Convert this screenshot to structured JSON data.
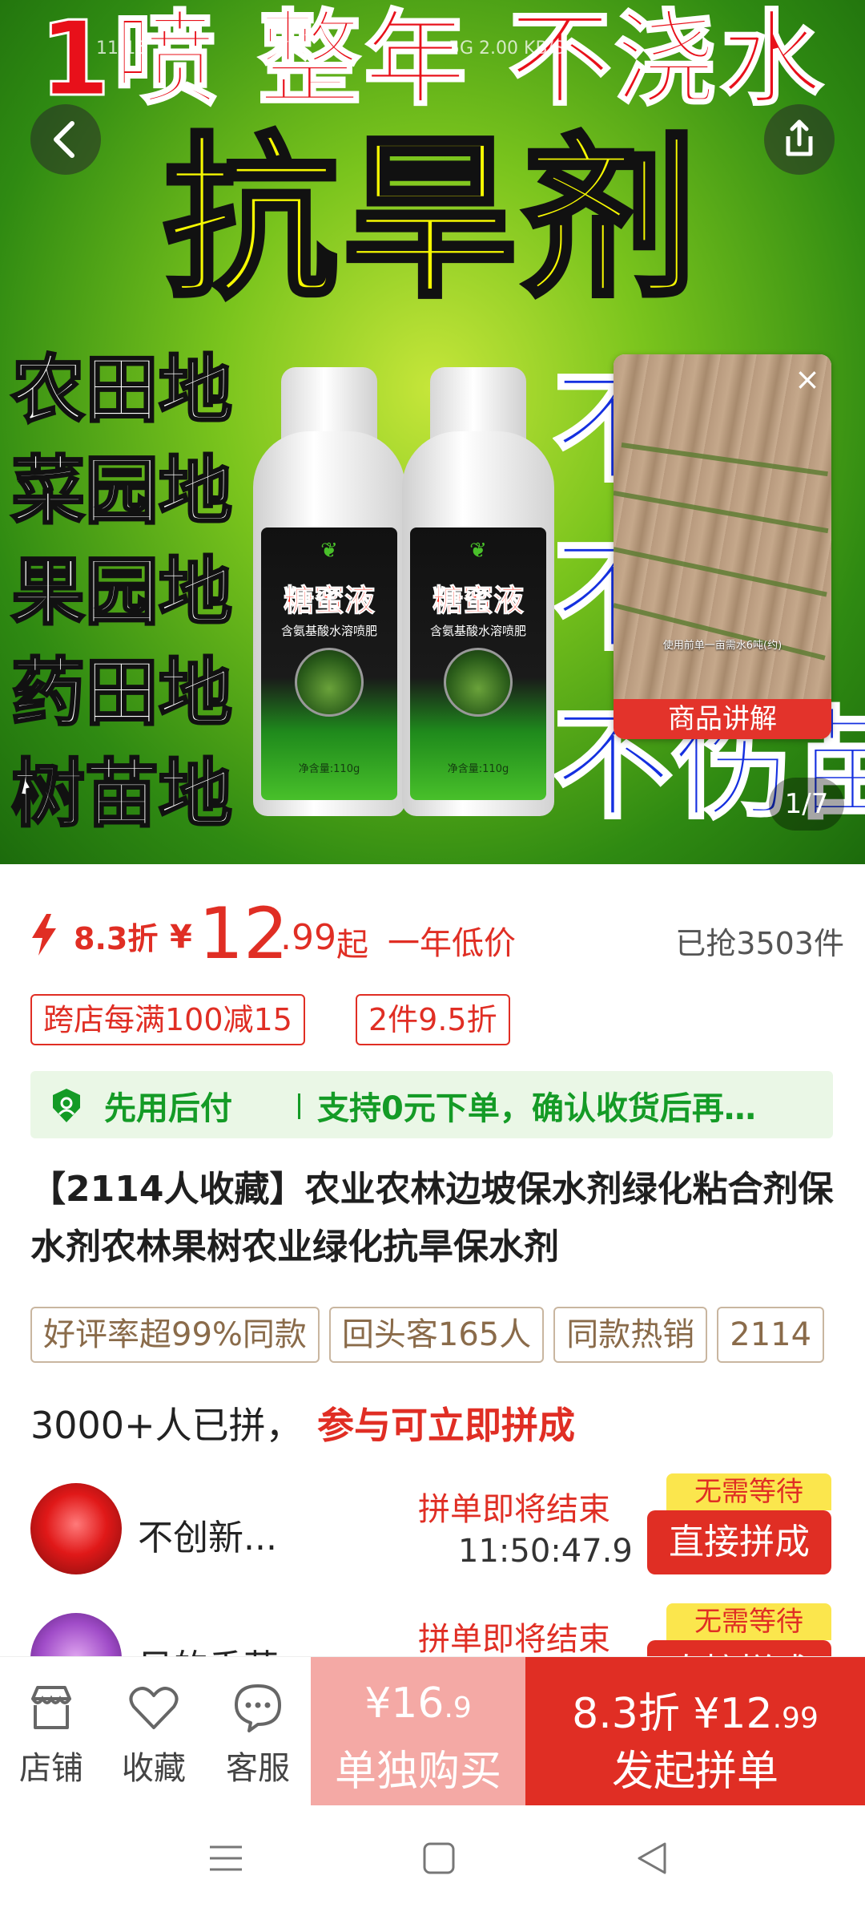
{
  "hero": {
    "headline": "1喷 整年 不浇水",
    "subhead": "抗旱剂",
    "uses": [
      "农田地",
      "菜园地",
      "果园地",
      "药田地",
      "树苗地"
    ],
    "right_lines": [
      "不伤",
      "不旱",
      "不伤苗"
    ],
    "bottle": {
      "brand": "糖蜜液",
      "description": "含氨基酸水溶喷肥",
      "net": "净含量:110g"
    },
    "status_bar": {
      "left": "11:15",
      "right": "5G 2.00 KB/S"
    },
    "counter": "1/7"
  },
  "video_pip": {
    "caption": "使用前单一亩需水6吨(约)",
    "label": "商品讲解"
  },
  "price": {
    "discount": "8.3折",
    "currency": "¥",
    "integer": "12",
    "decimal": ".99",
    "suffix": "起",
    "slogan": "一年低价",
    "sold": "已抢3503件"
  },
  "coupons": [
    "跨店每满100减15",
    "2件9.5折"
  ],
  "bnpl": {
    "title": "先用后付",
    "text": "支持0元下单，确认收货后再…"
  },
  "product_title": "【2114人收藏】农业农林边坡保水剂绿化粘合剂保水剂农林果树农业绿化抗旱保水剂",
  "tags": [
    "好评率超99%同款",
    "回头客165人",
    "同款热销",
    "2114"
  ],
  "group_buy": {
    "count_text": "3000+人已拼，",
    "join_text": "参与可立即拼成",
    "rows": [
      {
        "name": "不创新...",
        "status": "拼单即将结束",
        "timer": "11:50:47.9",
        "badge": "无需等待",
        "button": "直接拼成"
      },
      {
        "name": "风的香草...",
        "status": "拼单即将结束",
        "timer": "",
        "badge": "无需等待",
        "button": "直接拼成"
      }
    ]
  },
  "bottom_bar": {
    "store": "店铺",
    "favorite": "收藏",
    "service": "客服",
    "buy_alone_price_int": "¥16",
    "buy_alone_price_dec": ".9",
    "buy_alone_label": "单独购买",
    "buy_group_price": "8.3折 ¥12",
    "buy_group_price_dec": ".99",
    "buy_group_label": "发起拼单"
  },
  "icons": {
    "back": "chevron-left-icon",
    "share": "share-icon",
    "close": "close-icon",
    "bolt": "lightning-icon",
    "bnpl": "shield-check-icon",
    "store": "store-icon",
    "favorite": "heart-icon",
    "service": "chat-icon"
  },
  "colors": {
    "accent": "#e02e24",
    "bnpl_green": "#149b26",
    "tag_brown": "#8a6b4a",
    "badge_yellow": "#fbe64d",
    "buy_alone_bg": "#f4a9a5"
  }
}
